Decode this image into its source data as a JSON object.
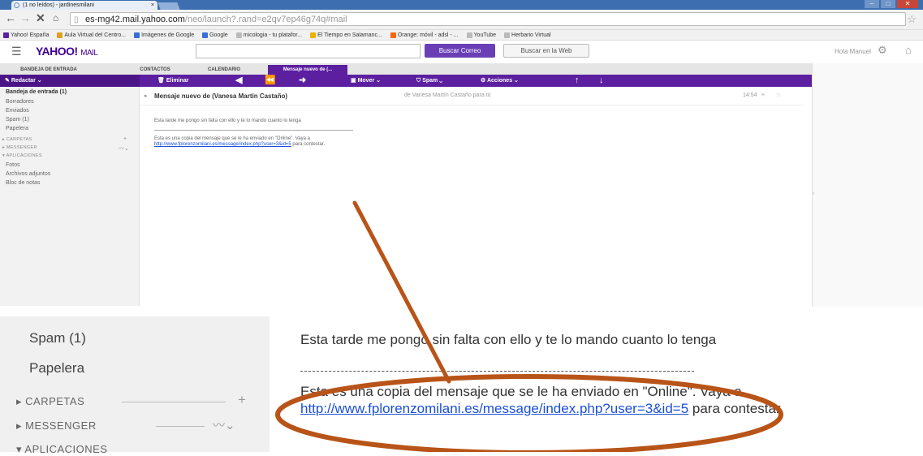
{
  "browser": {
    "tab_title": "(1 no leídos) - jardinesmilani",
    "tab_close": "×",
    "url_host": "es-mg42.mail.yahoo.com",
    "url_rest": "/neo/launch?.rand=e2qv7ep46g74q#mail",
    "bookmarks": [
      {
        "label": "Yahoo! España",
        "color": "#5b1fa0"
      },
      {
        "label": "Aula Virtual del Centro...",
        "color": "#e0a020"
      },
      {
        "label": "Imágenes de Google",
        "color": "#3a6fd8"
      },
      {
        "label": "Google",
        "color": "#3a6fd8"
      },
      {
        "label": "micologia - tu platafor...",
        "color": "#bbbbbb"
      },
      {
        "label": "El Tiempo en Salamanc...",
        "color": "#f0b000"
      },
      {
        "label": "Orange: móvil - adsl - ...",
        "color": "#ff6600"
      },
      {
        "label": "YouTube",
        "color": "#bbbbbb"
      },
      {
        "label": "Herbario Virtual",
        "color": "#bbbbbb"
      }
    ]
  },
  "header": {
    "logo": "YAHOO!",
    "logo_suffix": "MAIL",
    "search_mail_btn": "Buscar Correo",
    "search_web_btn": "Buscar en la Web",
    "greeting": "Hola Manuel"
  },
  "tabs": [
    "BANDEJA DE ENTRADA",
    "CONTACTOS",
    "CALENDARIO",
    "Mensaje nuevo de (..."
  ],
  "toolbar": {
    "compose": "Redactar",
    "delete": "Eliminar",
    "move": "Mover",
    "spam": "Spam",
    "actions": "Acciones"
  },
  "sidebar": {
    "inbox": "Bandeja de entrada (1)",
    "drafts": "Borradores",
    "sent": "Enviados",
    "spam": "Spam (1)",
    "trash": "Papelera",
    "folders": "CARPETAS",
    "messenger": "MESSENGER",
    "apps": "APLICACIONES",
    "photos": "Fotos",
    "attachments": "Archivos adjuntos",
    "notes": "Bloc de notas"
  },
  "message": {
    "subject": "Mensaje nuevo de (Vanesa Martín Castaño)",
    "from_line": "de Vanesa Martín Castaño para tú",
    "time": "14:54",
    "body_line1": "Esta tarde me pongo sin falta con ello y te lo mando cuanto lo tenga",
    "body_line2": "Esta es una copia del mensaje que se le ha enviado en \"Online\". Vaya a",
    "link": "http://www.fplorenzomilani.es/message/index.php?user=3&id=5",
    "after_link": " para contestar."
  },
  "zoom": {
    "spam": "Spam (1)",
    "trash": "Papelera",
    "folders": "CARPETAS",
    "messenger": "MESSENGER",
    "apps": "APLICACIONES",
    "body_line1": "Esta tarde me pongo sin falta con ello y te lo mando cuanto lo tenga",
    "body_line2": "Esta es una copia del mensaje que se le ha enviado en \"Online\". Vaya a",
    "link": "http://www.fplorenzomilani.es/message/index.php?user=3&id=5",
    "after_link": " para contestar"
  },
  "annotation_color": "#b85418"
}
